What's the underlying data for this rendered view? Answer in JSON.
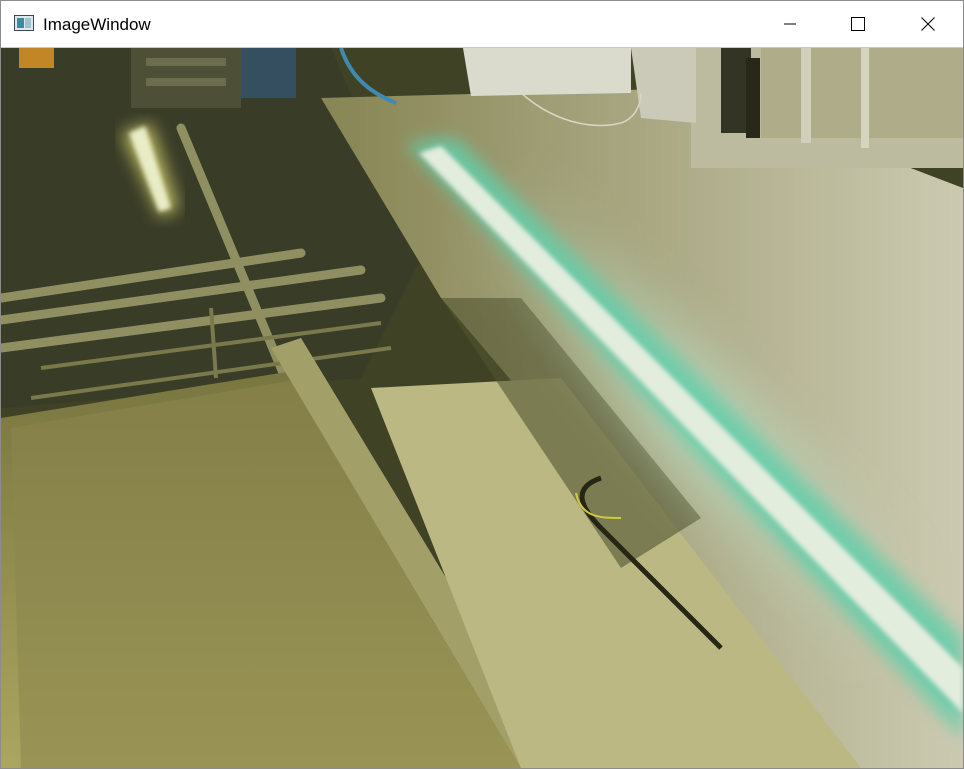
{
  "window": {
    "title": "ImageWindow",
    "icon": "image-window-icon"
  },
  "controls": {
    "minimize_icon": "minimize-icon",
    "maximize_icon": "maximize-icon",
    "close_icon": "close-icon"
  },
  "image": {
    "description_icon": "camera-frame",
    "dominant_colors": [
      "#a9a35c",
      "#e8fff4",
      "#6fe0c0",
      "#3a3e28",
      "#eae9dd"
    ]
  }
}
